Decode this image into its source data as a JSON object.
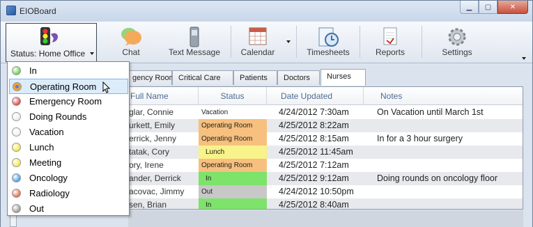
{
  "window": {
    "title": "EIOBoard"
  },
  "toolbar": {
    "status_label": "Status: Home Office",
    "chat": "Chat",
    "text_message": "Text Message",
    "calendar": "Calendar",
    "timesheets": "Timesheets",
    "reports": "Reports",
    "settings": "Settings"
  },
  "status_menu": [
    {
      "label": "In",
      "color": "#6ad44c"
    },
    {
      "label": "Operating Room",
      "color": "#f0a23a"
    },
    {
      "label": "Emergency Room",
      "color": "#e34a4a"
    },
    {
      "label": "Doing Rounds",
      "color": "#e8ecf3"
    },
    {
      "label": "Vacation",
      "color": "#eef1f5"
    },
    {
      "label": "Lunch",
      "color": "#f4e64a"
    },
    {
      "label": "Meeting",
      "color": "#f4e84e"
    },
    {
      "label": "Oncology",
      "color": "#4aa0e6"
    },
    {
      "label": "Radiology",
      "color": "#e0724a"
    },
    {
      "label": "Out",
      "color": "#9a9a9a"
    }
  ],
  "tabs": [
    "gency Room",
    "Critical Care",
    "Patients",
    "Doctors",
    "Nurses"
  ],
  "grid": {
    "headers": [
      "Full Name",
      "Status",
      "Date Updated",
      "Notes"
    ],
    "rows": [
      {
        "name": "glar, Connie",
        "status": "Vacation",
        "status_color": "#f2f2f2",
        "date": "4/24/2012  7:30am",
        "notes": "On Vacation until March 1st"
      },
      {
        "name": "urkett, Emily",
        "status": "Operating Room",
        "status_color": "#f7c07e",
        "date": "4/25/2012  8:22am",
        "notes": ""
      },
      {
        "name": "errick, Jenny",
        "status": "Operating Room",
        "status_color": "#f7c07e",
        "date": "4/25/2012  8:15am",
        "notes": "In for a 3 hour surgery"
      },
      {
        "name": "tatak, Cory",
        "status": "Lunch",
        "status_color": "#f8f38a",
        "date": "4/25/2012 11:45am",
        "notes": ""
      },
      {
        "name": "ory, Irene",
        "status": "Operating Room",
        "status_color": "#f7c07e",
        "date": "4/25/2012  7:12am",
        "notes": ""
      },
      {
        "name": "ander, Derrick",
        "status": "In",
        "status_color": "#7de36a",
        "date": "4/25/2012  9:12am",
        "notes": "Doing rounds on oncology floor"
      },
      {
        "name": "acovac, Jimmy",
        "status": "Out",
        "status_color": "#c8c8c8",
        "date": "4/24/2012 10:50pm",
        "notes": ""
      },
      {
        "name": "sen, Brian",
        "status": "In",
        "status_color": "#7de36a",
        "date": "4/25/2012  8:40am",
        "notes": ""
      }
    ]
  },
  "side_strip": "R"
}
